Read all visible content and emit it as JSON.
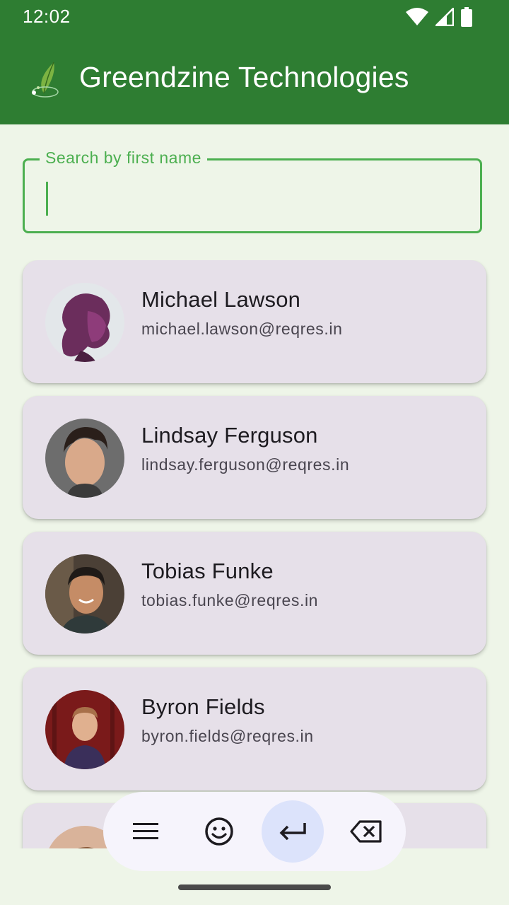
{
  "status_bar": {
    "time": "12:02",
    "icons": [
      "wifi-icon",
      "signal-icon",
      "battery-icon"
    ]
  },
  "app_bar": {
    "title": "Greendzine Technologies",
    "logo": "greendzine-leaf-logo",
    "background_color": "#2e7d32"
  },
  "search": {
    "label": "Search by first name",
    "value": "",
    "accent_color": "#4caf50"
  },
  "users": [
    {
      "name": "Michael Lawson",
      "email": "michael.lawson@reqres.in"
    },
    {
      "name": "Lindsay Ferguson",
      "email": "lindsay.ferguson@reqres.in"
    },
    {
      "name": "Tobias Funke",
      "email": "tobias.funke@reqres.in"
    },
    {
      "name": "Byron Fields",
      "email": "byron.fields@reqres.in"
    },
    {
      "name": "",
      "email": ""
    }
  ],
  "keyboard_toolbar": {
    "buttons": [
      "menu-icon",
      "emoji-icon",
      "enter-icon",
      "backspace-icon"
    ],
    "active": "enter-icon"
  }
}
